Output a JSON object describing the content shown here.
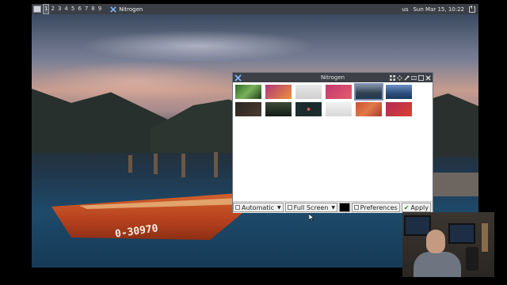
{
  "panel": {
    "workspaces": [
      "1",
      "2",
      "3",
      "4",
      "5",
      "6",
      "7",
      "8",
      "9"
    ],
    "active_workspace": "1",
    "task_label": "Nitrogen",
    "keyboard_layout": "us",
    "clock": "Sun Mar 15, 10:22"
  },
  "wallpaper": {
    "boat_label": "0-30970"
  },
  "window": {
    "title": "Nitrogen",
    "controls": [
      "grid-icon",
      "move-icon",
      "pin-icon",
      "collapse-icon",
      "close-icon"
    ],
    "thumbnails": [
      [
        {
          "name": "thumb-green-leaves",
          "gradient": "linear-gradient(135deg,#2f6a2a,#79b15a,#1e3f1b)"
        },
        {
          "name": "thumb-orange-purple",
          "gradient": "linear-gradient(135deg,#b0387b,#ee8f3a)"
        },
        {
          "name": "thumb-grey-soft",
          "gradient": "linear-gradient(180deg,#e8e8e8,#cfcfcf)"
        },
        {
          "name": "thumb-magenta-moon",
          "gradient": "linear-gradient(135deg,#c13a6f,#e65a6c)"
        },
        {
          "name": "thumb-lake-mountains",
          "gradient": "linear-gradient(180deg,#7d8fa5,#313f4e 60%,#1f3a52)",
          "selected": true
        },
        {
          "name": "thumb-blue-mountains",
          "gradient": "linear-gradient(180deg,#6d90c6,#2d4f7c 60%,#1d3760)"
        }
      ],
      [
        {
          "name": "thumb-dark-gradient",
          "gradient": "linear-gradient(135deg,#2b2623,#4a3b2f)"
        },
        {
          "name": "thumb-dark-landscape",
          "gradient": "linear-gradient(180deg,#3b4a3a,#151c16)"
        },
        {
          "name": "thumb-dark-ring",
          "gradient": "radial-gradient(circle at 50% 50%,#e85c6a 8%,#1b2b2c 12%,#1e2f2e 100%)"
        },
        {
          "name": "thumb-light-grey",
          "gradient": "linear-gradient(180deg,#f2f2f2,#d8d8d8)"
        },
        {
          "name": "thumb-orange-pattern",
          "gradient": "linear-gradient(135deg,#c75432,#e17a4a,#a73a2e)"
        },
        {
          "name": "thumb-magenta-red",
          "gradient": "linear-gradient(135deg,#b32a5b,#d8402c)"
        }
      ]
    ],
    "toolbar": {
      "scale_mode": "Automatic",
      "screen_mode": "Full Screen",
      "bg_color": "#000000",
      "preferences_label": "Preferences",
      "apply_label": "Apply"
    }
  },
  "colors": {
    "panel_bg": "#3b3e44",
    "window_title_bg": "#3c3f45",
    "selection": "#7e8fb4"
  }
}
